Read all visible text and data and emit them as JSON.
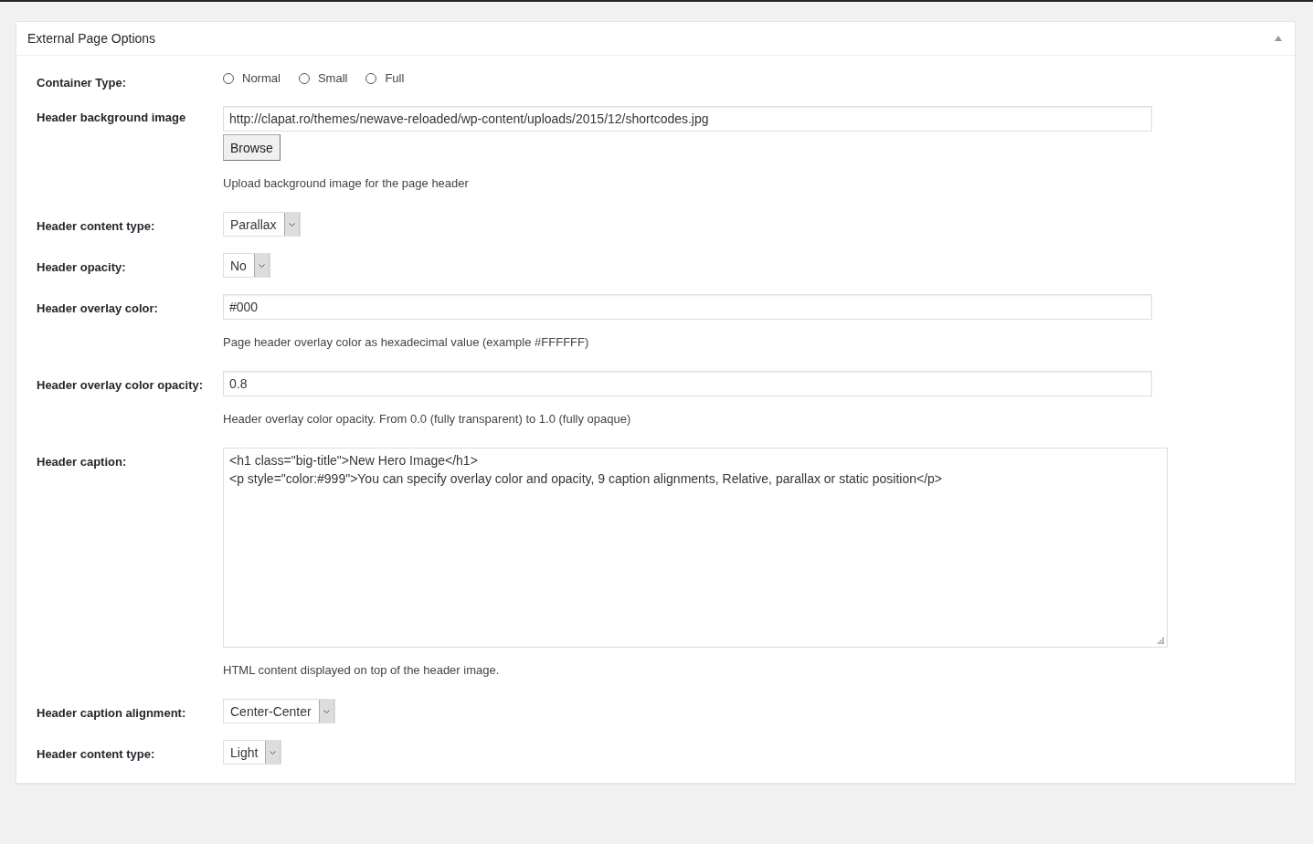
{
  "panel": {
    "title": "External Page Options",
    "expanded": true
  },
  "fields": [
    {
      "kind": "radio",
      "label": "Container Type:",
      "options": [
        {
          "label": "Normal",
          "selected": false
        },
        {
          "label": "Small",
          "selected": false
        },
        {
          "label": "Full",
          "selected": false
        }
      ]
    },
    {
      "kind": "upload",
      "label": "Header background image",
      "value": "http://clapat.ro/themes/newave-reloaded/wp-content/uploads/2015/12/shortcodes.jpg",
      "button": "Browse",
      "description": "Upload background image for the page header"
    },
    {
      "kind": "select",
      "label": "Header content type:",
      "value": "Parallax"
    },
    {
      "kind": "select",
      "label": "Header opacity:",
      "value": "No"
    },
    {
      "kind": "text",
      "label": "Header overlay color:",
      "value": "#000",
      "description": "Page header overlay color as hexadecimal value (example #FFFFFF)"
    },
    {
      "kind": "text",
      "label": "Header overlay color opacity:",
      "value": "0.8",
      "description": "Header overlay color opacity. From 0.0 (fully transparent) to 1.0 (fully opaque)"
    },
    {
      "kind": "textarea",
      "label": "Header caption:",
      "lines": [
        "<h1 class=\"big-title\">New Hero Image</h1>",
        "<p style=\"color:#999\">You can specify overlay color and opacity, 9 caption alignments, Relative, parallax or static position</p>"
      ],
      "description": "HTML content displayed on top of the header image."
    },
    {
      "kind": "select",
      "label": "Header caption alignment:",
      "value": "Center-Center"
    },
    {
      "kind": "select",
      "label": "Header content type:",
      "value": "Light"
    }
  ]
}
